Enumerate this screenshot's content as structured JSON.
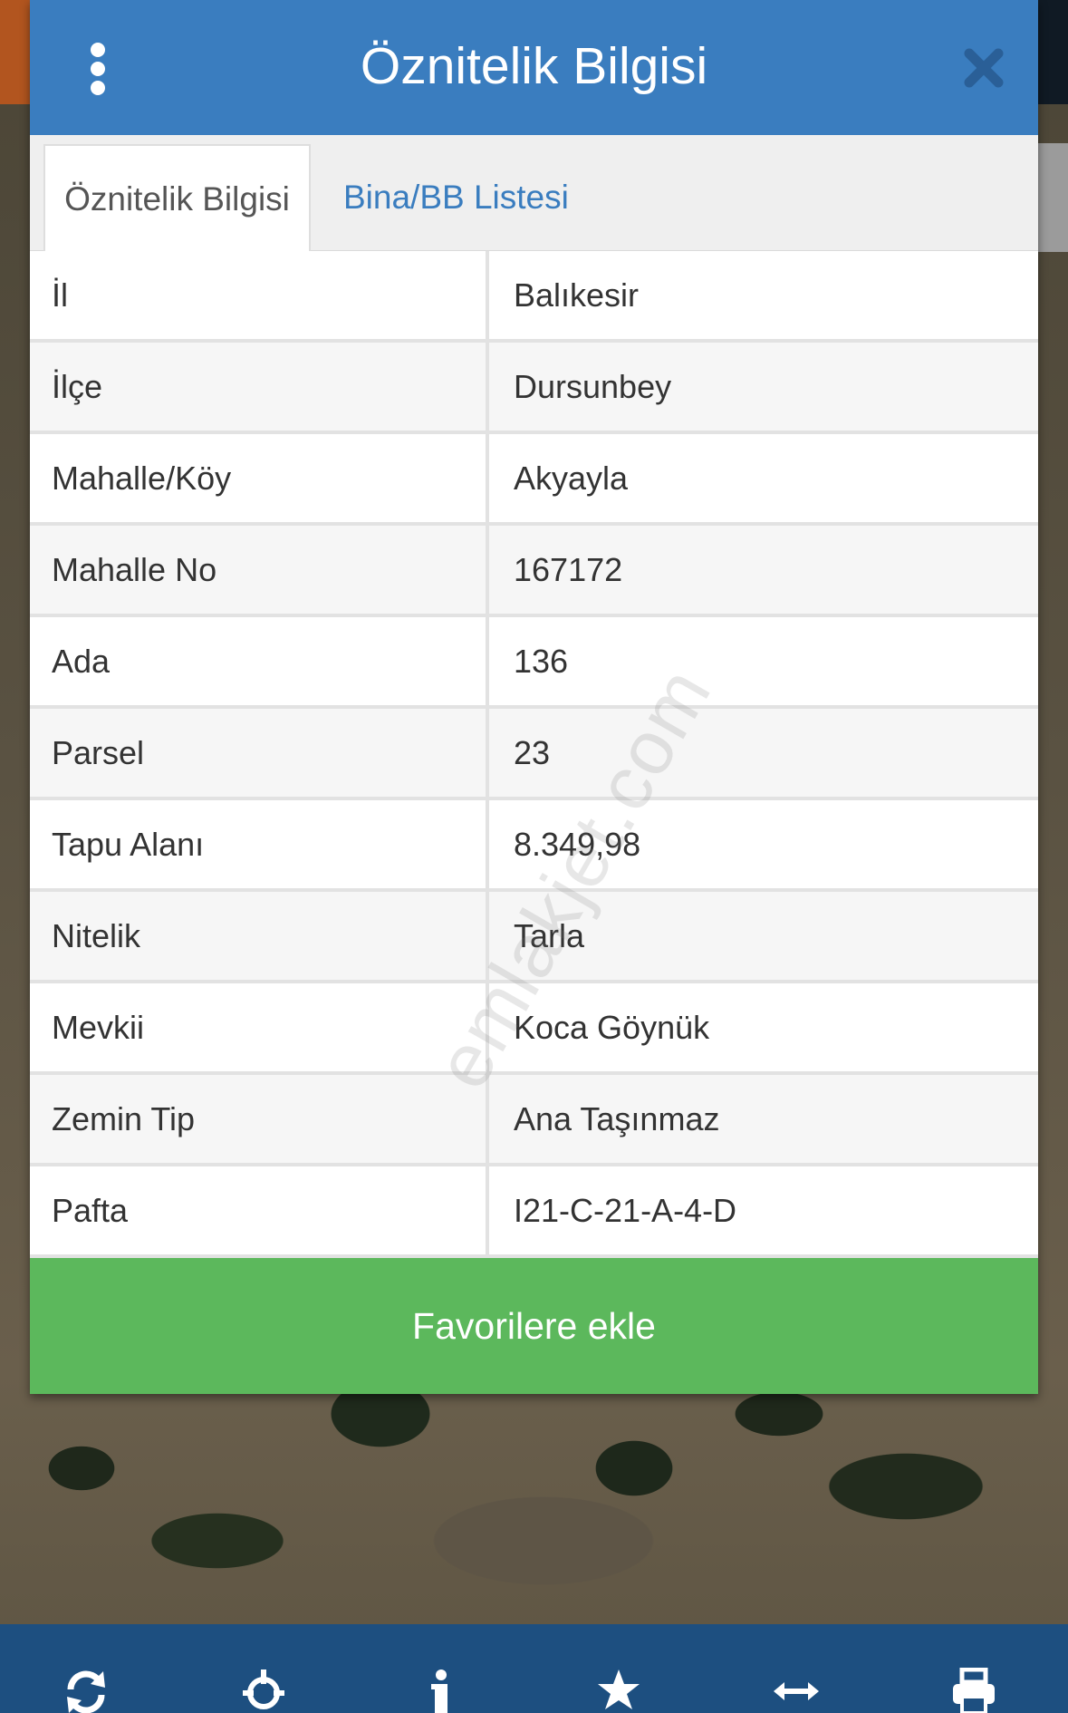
{
  "dialog": {
    "title": "Öznitelik Bilgisi",
    "tabs": [
      {
        "label": "Öznitelik Bilgisi",
        "active": true
      },
      {
        "label": "Bina/BB Listesi",
        "active": false
      }
    ],
    "rows": [
      {
        "key": "İl",
        "value": "Balıkesir"
      },
      {
        "key": "İlçe",
        "value": "Dursunbey"
      },
      {
        "key": "Mahalle/Köy",
        "value": "Akyayla"
      },
      {
        "key": "Mahalle No",
        "value": "167172"
      },
      {
        "key": "Ada",
        "value": "136"
      },
      {
        "key": "Parsel",
        "value": "23"
      },
      {
        "key": "Tapu Alanı",
        "value": "8.349,98"
      },
      {
        "key": "Nitelik",
        "value": "Tarla"
      },
      {
        "key": "Mevkii",
        "value": "Koca Göynük"
      },
      {
        "key": "Zemin Tip",
        "value": "Ana Taşınmaz"
      },
      {
        "key": "Pafta",
        "value": "I21-C-21-A-4-D"
      }
    ],
    "favorite_button": "Favorilere ekle"
  },
  "watermark": "emlakjet.com",
  "toolbar": {
    "icons": [
      "refresh-icon",
      "locate-icon",
      "info-icon",
      "star-icon",
      "measure-icon",
      "print-icon"
    ]
  },
  "colors": {
    "header": "#3a7dbf",
    "button": "#5cb85c",
    "toolbar": "#1d4f80",
    "tab_link": "#3a7dbf"
  }
}
